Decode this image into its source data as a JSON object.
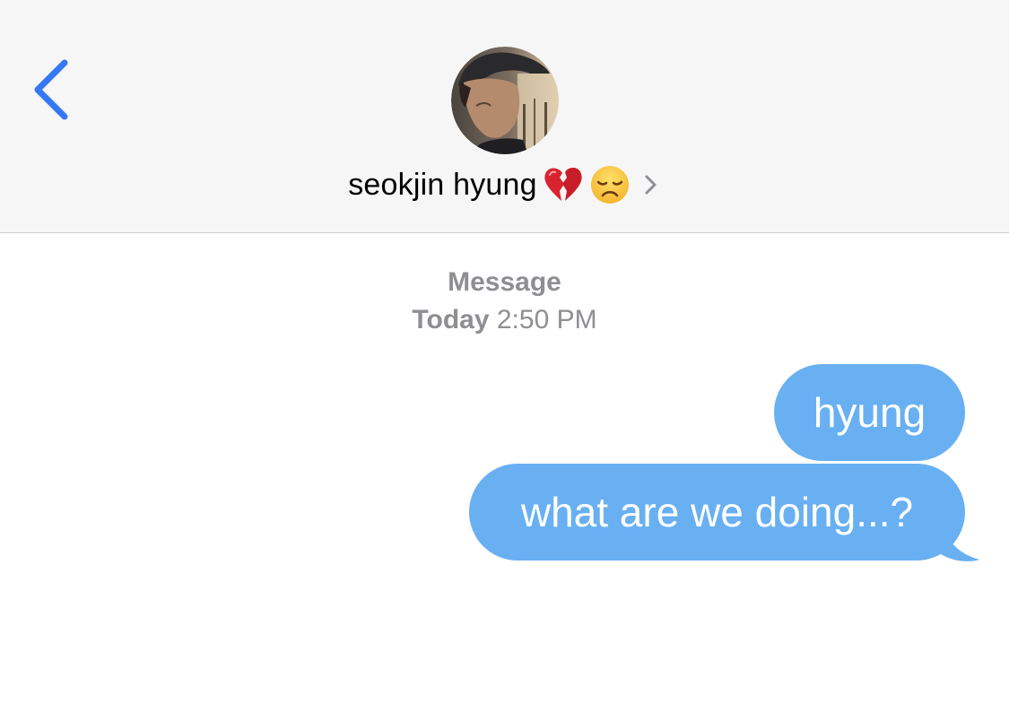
{
  "header": {
    "back_icon": "chevron-left-icon",
    "avatar_icon": "contact-photo",
    "contact_name": "seokjin hyung",
    "contact_emojis": [
      "broken-heart-emoji",
      "disappointed-face-emoji"
    ],
    "disclosure_icon": "chevron-right-icon"
  },
  "conversation": {
    "service_label": "Message",
    "timestamp_day": "Today",
    "timestamp_time": "2:50 PM",
    "messages": [
      {
        "text": "hyung",
        "sender": "me"
      },
      {
        "text": "what are we doing...?",
        "sender": "me"
      }
    ]
  },
  "colors": {
    "accent": "#3478f6",
    "bubble": "#68b0f2",
    "header_bg": "#f6f6f6",
    "meta_text": "#8e8e93"
  }
}
